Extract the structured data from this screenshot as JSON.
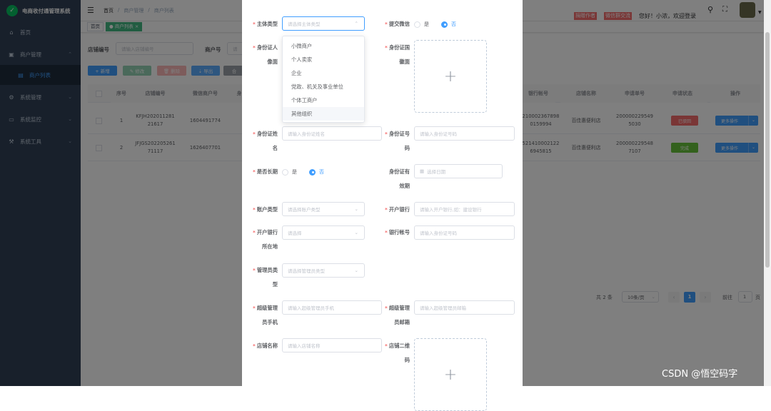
{
  "app": {
    "title": "电商收付通管理系统",
    "logo_glyph": "✓"
  },
  "sidebar": {
    "items": [
      {
        "label": "首页",
        "icon": "home-icon"
      },
      {
        "label": "商户管理",
        "icon": "shop-icon"
      },
      {
        "label": "商户列表",
        "icon": "list-icon"
      },
      {
        "label": "系统管理",
        "icon": "gear-icon"
      },
      {
        "label": "系统监控",
        "icon": "monitor-icon"
      },
      {
        "label": "系统工具",
        "icon": "tool-icon"
      }
    ]
  },
  "header": {
    "breadcrumb": [
      "首页",
      "商户管理",
      "商户列表"
    ],
    "badge_donate": "捐赠作者",
    "badge_wechat": "微信群交流",
    "greeting": "您好！小浓，欢迎登录"
  },
  "tags": {
    "home": "首页",
    "current": "商户列表"
  },
  "search": {
    "store_no_label": "店铺编号",
    "store_no_placeholder": "请输入店铺编号",
    "merchant_no_label": "商户号",
    "merchant_no_placeholder": "请"
  },
  "toolbar": {
    "add": "+ 新增",
    "edit": "✎ 修改",
    "delete": "🗑 删除",
    "export": "⇣ 导出",
    "more": "合"
  },
  "table": {
    "columns": [
      "序号",
      "店铺编号",
      "微信商户号",
      "身",
      "银行帐号",
      "店铺名称",
      "申请单号",
      "申请状态",
      "操作"
    ],
    "rows": [
      {
        "index": "1",
        "store_no_1": "KFJH202011281",
        "store_no_2": "21617",
        "wx_mch": "1604491774",
        "bank_1": "210002367898",
        "bank_2": "0159994",
        "store_name": "百佳惠便利店",
        "apply_1": "200000229549",
        "apply_2": "5030",
        "status": "已驳回",
        "status_color": "#f56c6c",
        "action": "更多操作"
      },
      {
        "index": "2",
        "store_no_1": "JFJGS202205261",
        "store_no_2": "71117",
        "wx_mch": "1626407701",
        "bank_1": "521410002122",
        "bank_2": "6945815",
        "store_name": "百佳惠便利店",
        "apply_1": "200000229548",
        "apply_2": "7107",
        "status": "完成",
        "status_color": "#67c23a",
        "action": "更多操作"
      }
    ]
  },
  "pagination": {
    "total": "共 2 条",
    "page_size": "10条/页",
    "current_page": "1",
    "goto_label": "前往",
    "goto_value": "1",
    "page_suffix": "页"
  },
  "form": {
    "subject_type_label": "主体类型",
    "subject_type_placeholder": "请选择主体类型",
    "submit_wechat_label": "提交微信",
    "yes": "是",
    "no": "否",
    "id_holder_label_1": "身份证人",
    "id_holder_label_2": "像面",
    "id_back_label_1": "身份证国",
    "id_back_label_2": "徽面",
    "id_name_label_1": "身份证姓",
    "id_name_label_2": "名",
    "id_name_placeholder": "请输入身份证姓名",
    "id_no_label_1": "身份证号",
    "id_no_label_2": "码",
    "id_no_placeholder": "请输入身份证号码",
    "long_term_label": "是否长期",
    "valid_label_1": "身份证有",
    "valid_label_2": "效期",
    "valid_placeholder": "选择日期",
    "account_type_label": "账户类型",
    "account_type_placeholder": "请选择账户类型",
    "bank_label": "开户银行",
    "bank_placeholder": "请输入开户银行,如：建设银行",
    "bank_city_label_1": "开户银行",
    "bank_city_label_2": "所在地",
    "bank_city_placeholder": "请选择",
    "bank_account_label": "银行帐号",
    "bank_account_placeholder": "请输入身份证号码",
    "admin_type_label_1": "管理员类",
    "admin_type_label_2": "型",
    "admin_type_placeholder": "请选择管理员类型",
    "super_phone_label_1": "超级管理",
    "super_phone_label_2": "员手机",
    "super_phone_placeholder": "请输入超级管理员手机",
    "super_email_label_1": "超级管理",
    "super_email_label_2": "员邮箱",
    "super_email_placeholder": "请输入超级管理员邮箱",
    "store_name_label": "店铺名称",
    "store_name_placeholder": "请输入店铺名称",
    "store_qr_label_1": "店铺二维",
    "store_qr_label_2": "码",
    "upload_glyph": "+",
    "subject_options": [
      "小微商户",
      "个人卖家",
      "企业",
      "党政、机关及事业单位",
      "个体工商户",
      "其他组织"
    ]
  },
  "watermark": "CSDN @悟空码字",
  "colors": {
    "sidebar_bg": "#304156",
    "primary": "#409eff",
    "danger": "#f56c6c",
    "success": "#67c23a",
    "tag_active": "#42b983"
  }
}
